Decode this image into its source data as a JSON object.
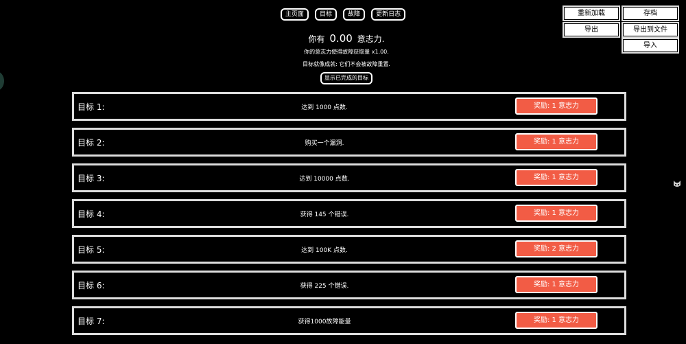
{
  "tabs": [
    "主页面",
    "目标",
    "故障",
    "更新日志"
  ],
  "save_panel": {
    "reload": "重新加载",
    "save": "存档",
    "export": "导出",
    "export_file": "导出到文件",
    "import": "导入"
  },
  "header": {
    "will_prefix": "你有",
    "will_value": "0.00",
    "will_suffix": "意志力.",
    "multiplier_text": "你的意志力使得故障获取量 x1.00.",
    "note_text": "目标就像成就: 它们不会被故障重置.",
    "show_completed": "显示已完成的目标"
  },
  "goals": [
    {
      "title": "目标 1:",
      "desc": "达到 1000 点数.",
      "reward": "奖励: 1 意志力"
    },
    {
      "title": "目标 2:",
      "desc": "购买一个漏洞.",
      "reward": "奖励: 1 意志力"
    },
    {
      "title": "目标 3:",
      "desc": "达到 10000 点数.",
      "reward": "奖励: 1 意志力"
    },
    {
      "title": "目标 4:",
      "desc": "获得 145 个错误.",
      "reward": "奖励: 1 意志力"
    },
    {
      "title": "目标 5:",
      "desc": "达到 100K 点数.",
      "reward": "奖励: 2 意志力"
    },
    {
      "title": "目标 6:",
      "desc": "获得 225 个错误.",
      "reward": "奖励: 1 意志力"
    },
    {
      "title": "目标 7:",
      "desc": "获得1000故障能量",
      "reward": "奖励: 1 意志力"
    }
  ],
  "icons": {
    "side": "circle-tab-icon",
    "corner": "cat-icon"
  }
}
